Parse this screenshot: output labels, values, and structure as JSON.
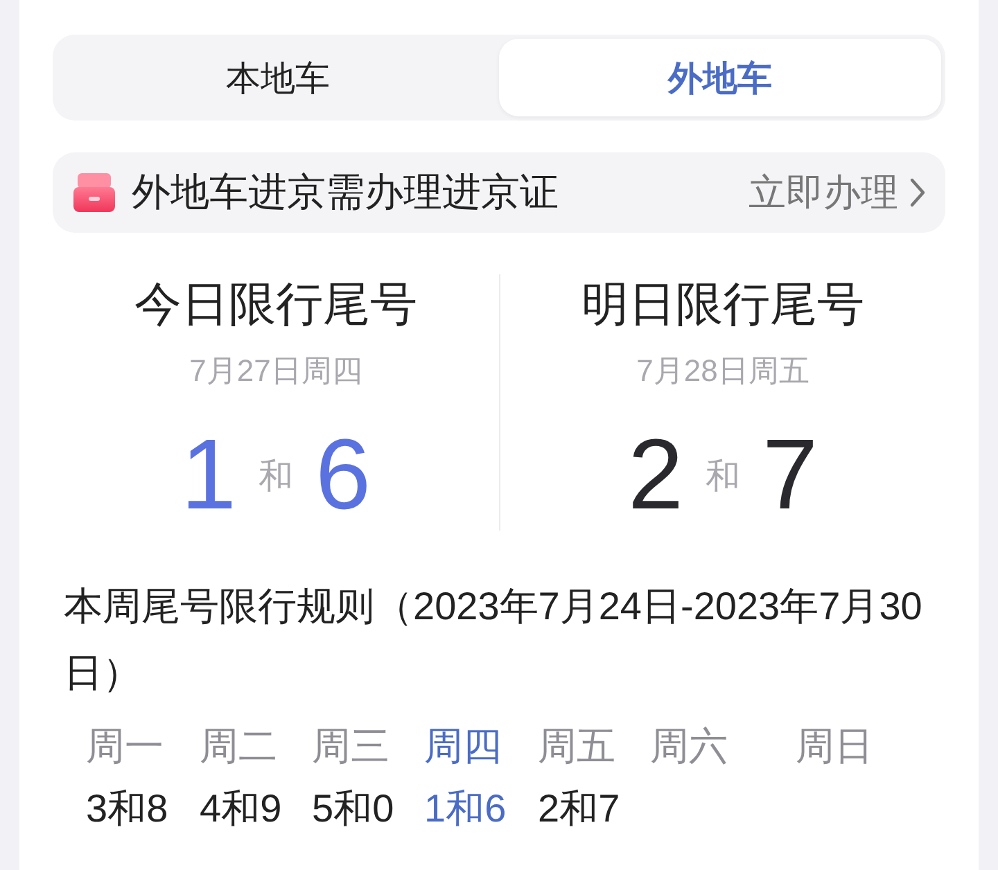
{
  "tabs": [
    {
      "label": "本地车",
      "selected": false
    },
    {
      "label": "外地车",
      "selected": true
    }
  ],
  "notice": {
    "text": "外地车进京需办理进京证",
    "action": "立即办理"
  },
  "restrictions": [
    {
      "title": "今日限行尾号",
      "date": "7月27日周四",
      "numbers": [
        "1",
        "6"
      ],
      "joiner": "和",
      "highlighted": true
    },
    {
      "title": "明日限行尾号",
      "date": "7月28日周五",
      "numbers": [
        "2",
        "7"
      ],
      "joiner": "和",
      "highlighted": false
    }
  ],
  "weekly": {
    "title": "本周尾号限行规则（2023年7月24日-2023年7月30日）",
    "days": [
      {
        "label": "周一",
        "value": "3和8",
        "highlighted": false
      },
      {
        "label": "周二",
        "value": "4和9",
        "highlighted": false
      },
      {
        "label": "周三",
        "value": "5和0",
        "highlighted": false
      },
      {
        "label": "周四",
        "value": "1和6",
        "highlighted": true
      },
      {
        "label": "周五",
        "value": "2和7",
        "highlighted": false
      },
      {
        "label": "周六",
        "highlighted": false
      },
      {
        "label": "周日",
        "highlighted": false
      }
    ]
  }
}
